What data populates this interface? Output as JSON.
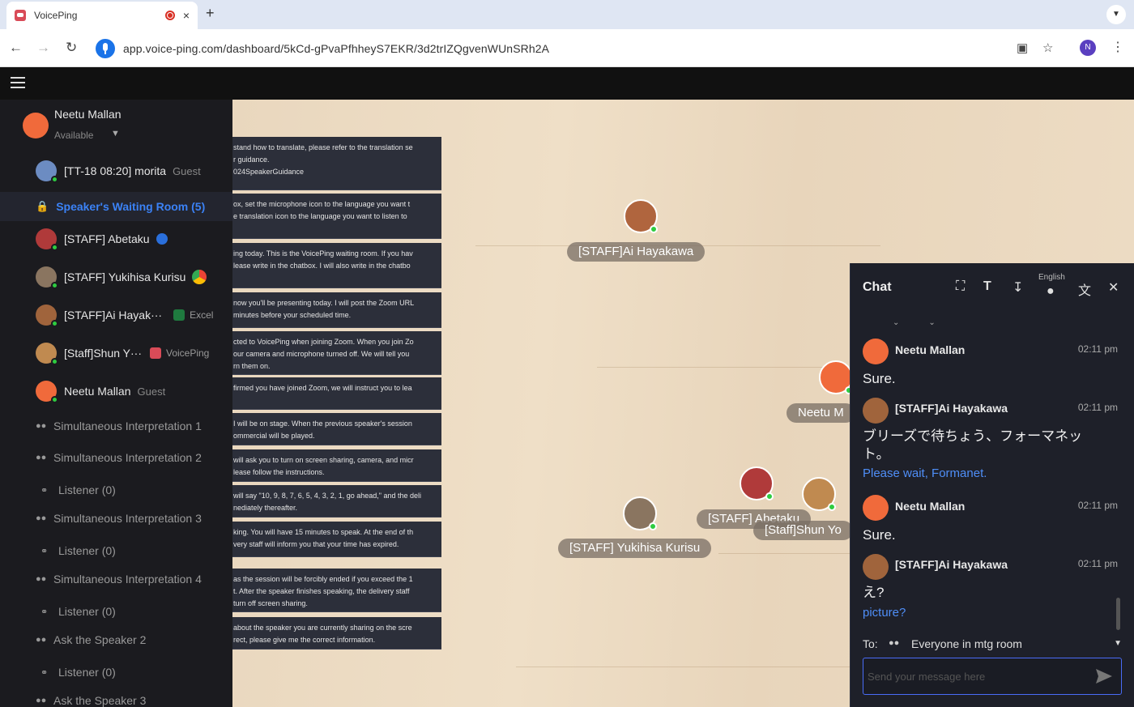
{
  "browser": {
    "tab_title": "VoicePing",
    "tab_close": "×",
    "new_tab": "+",
    "url": "app.voice-ping.com/dashboard/5kCd-gPvaPfhheyS7EKR/3d2trIZQgvenWUnSRh2A",
    "profile_initial": "N"
  },
  "sidebar": {
    "me": {
      "name": "Neetu Mallan",
      "status": "Available"
    },
    "rows": [
      {
        "name": "[TT-18 08:20] morita",
        "tag": "Guest"
      },
      {
        "name": "Speaker's Waiting Room (5)"
      },
      {
        "name": "[STAFF] Abetaku"
      },
      {
        "name": "[STAFF] Yukihisa Kurisu"
      },
      {
        "name": "[STAFF]Ai Hayak···",
        "app": "Excel"
      },
      {
        "name": "[Staff]Shun Y···",
        "app": "VoicePing"
      },
      {
        "name": "Neetu Mallan",
        "tag": "Guest"
      },
      {
        "name": "Simultaneous Interpretation 1"
      },
      {
        "name": "Simultaneous Interpretation 2"
      },
      {
        "name": "Listener (0)"
      },
      {
        "name": "Simultaneous Interpretation 3"
      },
      {
        "name": "Listener (0)"
      },
      {
        "name": "Simultaneous Interpretation 4"
      },
      {
        "name": "Listener (0)"
      },
      {
        "name": "Ask the Speaker 2"
      },
      {
        "name": "Listener (0)"
      },
      {
        "name": "Ask the Speaker 3"
      }
    ]
  },
  "notes": [
    "stand how to translate, please refer to the translation se\nr guidance.\n024SpeakerGuidance",
    "ox, set the microphone icon to the language you want t\ne translation icon to the language you want to listen to",
    "ing today. This is the VoicePing waiting room. If you hav\nlease write in the chatbox. I will also write in the chatbo",
    "now you'll be presenting today. I will post the Zoom URL\nminutes before your scheduled time.",
    "cted to VoicePing when joining Zoom. When you join Zo\nour camera and microphone turned off. We will tell you\nrn them on.",
    "firmed you have joined Zoom, we will instruct you to lea",
    "I will be on stage. When the previous speaker's session\nommercial will be played.",
    "will ask you to turn on screen sharing, camera, and micr\nlease follow the instructions.",
    "will say \"10, 9, 8, 7, 6, 5, 4, 3, 2, 1, go ahead,\" and the deli\nnediately thereafter.",
    "king. You will have 15 minutes to speak. At the end of th\nvery staff will inform you that your time has expired.",
    "as the session will be forcibly ended if you exceed the 1\nt. After the speaker finishes speaking, the delivery staff\nturn off screen sharing.",
    "about the speaker you are currently sharing on the scre\nrect, please give me the correct information."
  ],
  "stage": {
    "labels": {
      "ai": "[STAFF]Ai Hayakawa",
      "neetu": "Neetu M",
      "abetaku": "[STAFF] Abetaku",
      "shun": "[Staff]Shun Yo",
      "yukihisa": "[STAFF] Yukihisa Kurisu"
    }
  },
  "chat": {
    "title": "Chat",
    "lang_label": "English",
    "messages": [
      {
        "name": "Neetu Mallan",
        "time": "02:11 pm",
        "text": "Sure."
      },
      {
        "name": "[STAFF]Ai Hayakawa",
        "time": "02:11 pm",
        "text": "ブリーズで待ちょう、フォーマネット。",
        "translation": "Please wait, Formanet."
      },
      {
        "name": "Neetu Mallan",
        "time": "02:11 pm",
        "text": "Sure."
      },
      {
        "name": "[STAFF]Ai Hayakawa",
        "time": "02:11 pm",
        "text": "え?",
        "translation": "picture?"
      }
    ],
    "to_label": "To:",
    "to_value": "Everyone in mtg room",
    "input_placeholder": "Send your message here"
  },
  "colors": {
    "accent": "#3b82f6",
    "online": "#2ecc40",
    "sidebar_bg": "#1b1b1f",
    "chat_bg": "#1e2029"
  },
  "icons": {
    "tab": [
      "voiceping-favicon",
      "recording-icon",
      "close-icon",
      "plus-icon",
      "chevron-down-icon"
    ],
    "nav": [
      "back-arrow-icon",
      "forward-arrow-icon",
      "reload-icon",
      "mic-icon",
      "cast-icon",
      "star-icon",
      "more-vert-icon"
    ],
    "chat_tools": [
      "fullscreen-icon",
      "text-size-icon",
      "download-icon",
      "mic-icon",
      "translate-icon",
      "close-icon"
    ]
  }
}
